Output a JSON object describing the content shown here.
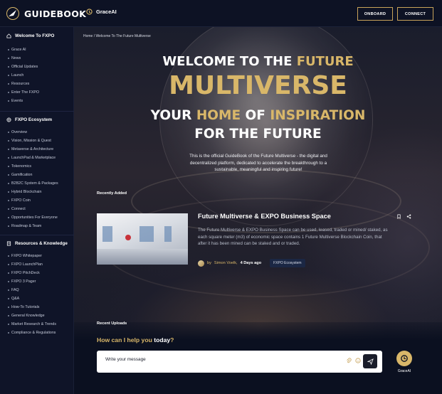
{
  "brand": {
    "name": "GUIDEBOOK"
  },
  "header": {
    "assistant_label": "GraceAI",
    "onboard_label": "ONBOARD",
    "connect_label": "CONNECT"
  },
  "sidebar": {
    "sections": [
      {
        "title": "Welcome To FXPO",
        "items": [
          "Grace AI",
          "News",
          "Official Updates",
          "Launch",
          "Resources",
          "Enter The FXPO",
          "Events"
        ]
      },
      {
        "title": "FXPO Ecosystem",
        "items": [
          "Overview",
          "Vision, Mission & Quest",
          "Metaverse & Architecture",
          "LaunchPad & Marketplace",
          "Tokenomics",
          "Gamification",
          "B2B2C System & Packages",
          "Hybrid Blockchain",
          "FXPO Coin",
          "Connect",
          "Opportunities For Everyone",
          "Roadmap & Team"
        ]
      },
      {
        "title": "Resources & Knowledge",
        "items": [
          "FXPO Whitepaper",
          "FXPO LaunchPlan",
          "FXPO PitchDeck",
          "FXPO 3 Pager",
          "FAQ",
          "Q&A",
          "How-To Tutorials",
          "General Knowledge",
          "Market Research & Trends",
          "Compliance & Regulations"
        ]
      }
    ]
  },
  "breadcrumb": {
    "home": "Home",
    "separator": "/",
    "current": "Welcome To The Future Multiverse"
  },
  "hero": {
    "line1_white": "WELCOME TO THE ",
    "line1_gold": "FUTURE",
    "line2": "MULTIVERSE",
    "line3_a": "YOUR ",
    "line3_b": "HOME",
    "line3_c": " OF ",
    "line3_d": "INSPIRATION",
    "line4": "FOR THE FUTURE",
    "intro": "This is the official GuideBook of the Future Multiverse - the digital and decentralized platform, dedicated to accelerate the breakthrough to a sustainable, meaningful and inspiring future!"
  },
  "recently_added": {
    "label": "Recently Added",
    "card": {
      "title": "Future Multiverse & EXPO Business Space",
      "description": "The Future Multiverse & EXPO Business Space can be used, leased, traded or mined/ staked, as each square meter (m3) of economic space contains 1 Future Multiverse Blockchain Coin, that after it has been mined can be staked and or traded.",
      "by": "by",
      "author": "Simon Voelk,",
      "ago": "4 Days ago",
      "tag": "FXPO Ecosystem"
    }
  },
  "recent_uploads": {
    "label": "Recent Uploads"
  },
  "chat": {
    "prompt_a": "How can I help you ",
    "prompt_b": "today",
    "prompt_c": "?",
    "placeholder": "Write your message",
    "assistant_label": "GraceAI"
  },
  "colors": {
    "accent": "#d9b769",
    "background": "#0b1020",
    "sidebar": "#0f1428"
  },
  "icons": [
    "logo-icon",
    "grace-ai-icon",
    "home-icon",
    "network-icon",
    "book-icon",
    "bookmark-icon",
    "share-icon",
    "attach-icon",
    "emoji-icon",
    "send-icon"
  ]
}
